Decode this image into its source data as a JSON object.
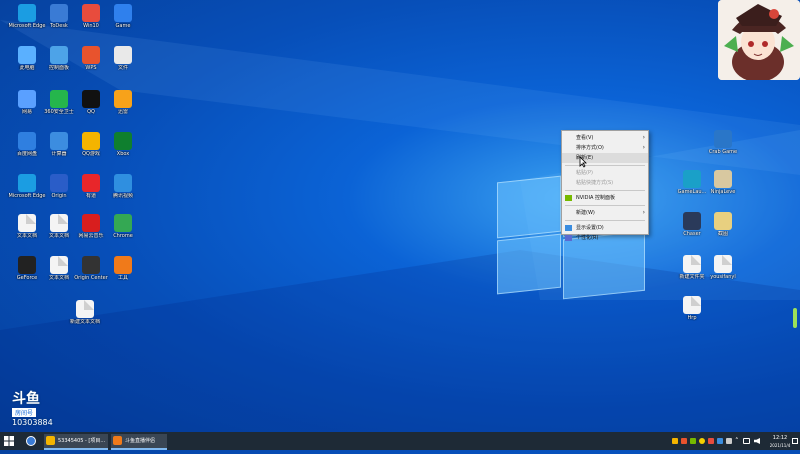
{
  "desktop": {
    "icons_left": [
      {
        "label": "Microsoft Edge",
        "color": "#1b9de2"
      },
      {
        "label": "ToDesk",
        "color": "#3a7bd5"
      },
      {
        "label": "Win10",
        "color": "#e84c3d"
      },
      {
        "label": "Game",
        "color": "#2f80ed"
      },
      {
        "label": "此电脑",
        "color": "#5ab0ff"
      },
      {
        "label": "控制面板",
        "color": "#4da3e8"
      },
      {
        "label": "WPS",
        "color": "#e8532d"
      },
      {
        "label": "文件",
        "color": "#e9e9e9"
      },
      {
        "label": "网易",
        "color": "#5aa0ff"
      },
      {
        "label": "360安全卫士",
        "color": "#25b64c"
      },
      {
        "label": "QQ",
        "color": "#111111"
      },
      {
        "label": "迅雷",
        "color": "#f7a21a"
      },
      {
        "label": "百度网盘",
        "color": "#2f7fe0"
      },
      {
        "label": "计算器",
        "color": "#3c8de0"
      },
      {
        "label": "QQ游戏",
        "color": "#f4b400"
      },
      {
        "label": "Xbox",
        "color": "#0f7f2e"
      },
      {
        "label": "Microsoft Edge",
        "color": "#1b9de2"
      },
      {
        "label": "Origin",
        "color": "#2a5dc8"
      },
      {
        "label": "有道",
        "color": "#e8262a"
      },
      {
        "label": "腾讯视频",
        "color": "#2f8fe0"
      },
      {
        "label": "文本文档",
        "color": "#f4f4f4"
      },
      {
        "label": "文本文档",
        "color": "#f4f4f4"
      },
      {
        "label": "网易云音乐",
        "color": "#d81e1e"
      },
      {
        "label": "Chrome",
        "color": "#34a853"
      },
      {
        "label": "GeForce",
        "color": "#222222"
      },
      {
        "label": "文本文档",
        "color": "#f4f4f4"
      },
      {
        "label": "Origin Center",
        "color": "#333333"
      },
      {
        "label": "工具",
        "color": "#f07a1a"
      },
      {
        "label": "新建文本文档",
        "color": "#f4f4f4"
      }
    ],
    "icons_right": [
      {
        "label": "Crab Game",
        "color": "#2a76c8"
      },
      {
        "label": "GameLau...",
        "color": "#1aa0c8"
      },
      {
        "label": "NinjaLeve",
        "color": "#d8c8a0"
      },
      {
        "label": "Chaser",
        "color": "#2a3a5a"
      },
      {
        "label": "截图",
        "color": "#e8d080"
      },
      {
        "label": "新建文件夹",
        "color": "#f4f4f4"
      },
      {
        "label": "yousifanyl",
        "color": "#f4f4f4"
      },
      {
        "label": "Hrp",
        "color": "#f4f4f4"
      }
    ]
  },
  "context_menu": {
    "items": [
      {
        "label": "查看(V)",
        "arrow": "›",
        "disabled": false
      },
      {
        "label": "排序方式(O)",
        "arrow": "›",
        "disabled": false
      },
      {
        "label": "刷新(E)",
        "arrow": "",
        "disabled": false
      },
      {
        "label": "粘贴(P)",
        "arrow": "",
        "disabled": true
      },
      {
        "label": "粘贴快捷方式(S)",
        "arrow": "",
        "disabled": true
      },
      {
        "label": "NVIDIA 控制面板",
        "arrow": "",
        "disabled": false
      },
      {
        "label": "新建(W)",
        "arrow": "›",
        "disabled": false
      },
      {
        "label": "显示设置(D)",
        "arrow": "",
        "disabled": false
      },
      {
        "label": "个性化(R)",
        "arrow": "",
        "disabled": false
      }
    ]
  },
  "watermark": {
    "brand": "斗鱼",
    "sub": "房间号",
    "room": "10303884"
  },
  "taskbar": {
    "app1": "53345405 - [项目...",
    "app2": "斗鱼直播伴侣",
    "clock_time": "12:12",
    "clock_date": "2021/11/4"
  },
  "colors": {
    "accent": "#7fb8f0",
    "taskbar": "#1e2a36"
  }
}
